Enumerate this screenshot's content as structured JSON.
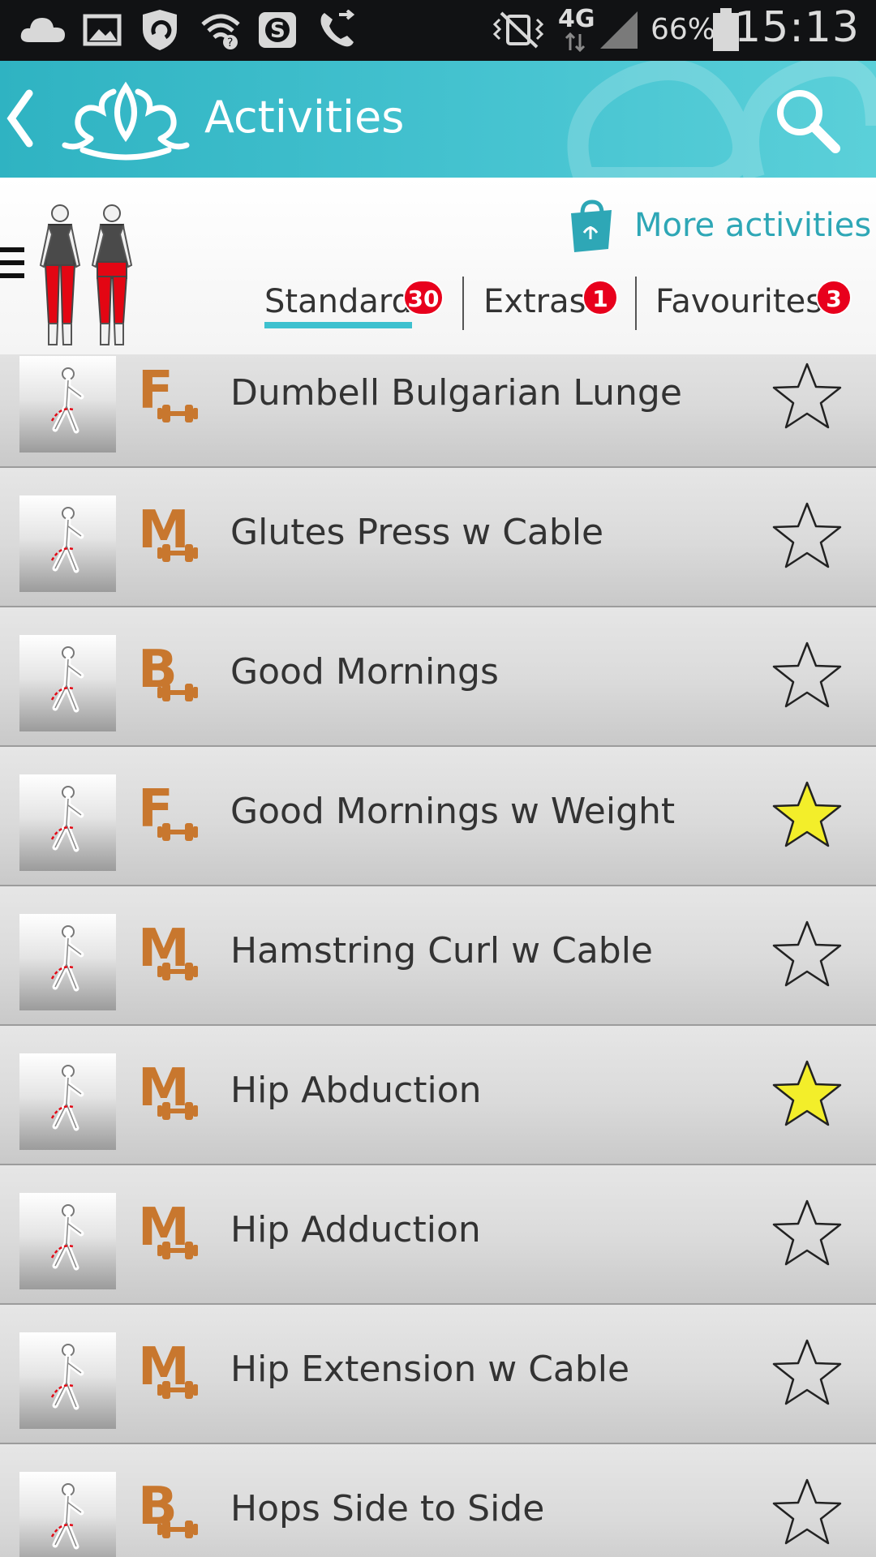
{
  "status_bar": {
    "network": "4G",
    "battery": "66%",
    "time": "15:13"
  },
  "app_bar": {
    "title": "Activities"
  },
  "header": {
    "more_activities": "More activities",
    "tabs": [
      {
        "label": "Standard",
        "badge": "30"
      },
      {
        "label": "Extras",
        "badge": "1"
      },
      {
        "label": "Favourites",
        "badge": "3"
      }
    ]
  },
  "exercises": [
    {
      "name": "Dumbell Bulgarian Lunge",
      "level": "F",
      "favourite": false
    },
    {
      "name": "Glutes Press w Cable",
      "level": "M",
      "favourite": false
    },
    {
      "name": "Good Mornings",
      "level": "B",
      "favourite": false
    },
    {
      "name": "Good Mornings w Weight",
      "level": "F",
      "favourite": true
    },
    {
      "name": "Hamstring Curl w Cable",
      "level": "M",
      "favourite": false
    },
    {
      "name": "Hip Abduction",
      "level": "M",
      "favourite": true
    },
    {
      "name": "Hip Adduction",
      "level": "M",
      "favourite": false
    },
    {
      "name": "Hip Extension w Cable",
      "level": "M",
      "favourite": false
    },
    {
      "name": "Hops Side to Side",
      "level": "B",
      "favourite": false
    }
  ],
  "colors": {
    "accent": "#3ec1cf",
    "level_orange": "#c8772e",
    "badge_red": "#e8001c",
    "star_fav": "#f3ee2a"
  }
}
